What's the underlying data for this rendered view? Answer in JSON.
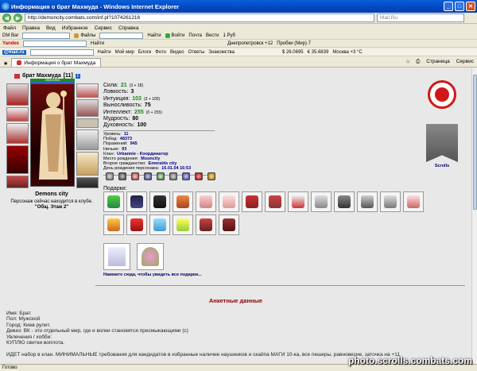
{
  "window": {
    "title": "Информация о брат Махмуда - Windows Internet Explorer"
  },
  "address": {
    "url": "http://demoncity.combats.com/inf.pl?1074261216",
    "search": "Mail.Ru"
  },
  "menu": [
    "Файл",
    "Правка",
    "Вид",
    "Избранное",
    "Сервис",
    "Справка"
  ],
  "toolbar1": {
    "dm": "DM Bar",
    "files": "Файлы",
    "find": "Найти",
    "enter": "Войти",
    "mail": "Почта",
    "news": "Вести",
    "rate": "1 Руб"
  },
  "toolbar2": {
    "yandex": "Yandex",
    "find": "Найти",
    "city": "Днепропетровск +12",
    "traffic": "Пробки (Мир) 7"
  },
  "toolbar3": {
    "mailru": "@mail.ru",
    "find": "Найти",
    "mymir": "Мой мир",
    "blogs": "Блоги",
    "photo": "Фото",
    "video": "Видео",
    "answers": "Ответы",
    "znak": "Знакомства",
    "usd": "$ 26.0695",
    "eur": "€ 35.6839",
    "moscow": "Москва +3 °C"
  },
  "tab": {
    "label": "Информация о брат Махмуда"
  },
  "tabtools": {
    "page": "Страница",
    "service": "Сервис"
  },
  "character": {
    "name": "брат Махмуда",
    "level": "[11]",
    "hp": "2500/2500",
    "city": "Demons city",
    "location_line": "Персонаж сейчас находится в клубе.",
    "location_room": "\"Общ. Этаж 2\""
  },
  "stats": [
    {
      "label": "Сила:",
      "value": "21",
      "extra": "(3 + 18)",
      "green": true
    },
    {
      "label": "Ловкость:",
      "value": "3",
      "extra": "",
      "green": false
    },
    {
      "label": "Интуиция:",
      "value": "103",
      "extra": "(3 + 100)",
      "green": true
    },
    {
      "label": "Выносливость:",
      "value": "75",
      "extra": "",
      "green": false
    },
    {
      "label": "Интеллект:",
      "value": "255",
      "extra": "(0 + 255)",
      "green": true
    },
    {
      "label": "Мудрость:",
      "value": "80",
      "extra": "",
      "green": false
    },
    {
      "label": "Духовность:",
      "value": "100",
      "extra": "",
      "green": false
    }
  ],
  "info": [
    {
      "label": "Уровень:",
      "value": "11"
    },
    {
      "label": "Побед:",
      "value": "48373"
    },
    {
      "label": "Поражений:",
      "value": "945"
    },
    {
      "label": "Ничьих:",
      "value": "93"
    },
    {
      "label": "Клан:",
      "value": "Urbannie - Координатор"
    },
    {
      "label": "Место рождения:",
      "value": "Mooncity"
    },
    {
      "label": "Второе гражданство:",
      "value": "Emeralds city"
    },
    {
      "label": "День рождения персонажа:",
      "value": "16.01.04 16:53"
    }
  ],
  "clan_banner": "Scrolls",
  "gifts_label": "Подарки:",
  "gifts_more": "Нажмите сюда, чтобы увидеть все подарки...",
  "anketa": {
    "heading": "Анкетные данные",
    "lines": [
      "Имя: Брат.",
      "Пол: Мужской",
      "Город: Киев рулит.",
      "Девиз: ВК - это отдельный мир, где и волки становятся пресмыкающими (с)",
      "Увлечения / хобби:",
      "КУПЛЮ свитки воплота.",
      "",
      "ИДЕТ набор в клан. МИНИМАЛЬНЫЕ требования для кандидатов в избранные   наличие наушников и скайпа МАГИ 10-ка, все пешеры, равновесие, заточка на +11"
    ]
  },
  "status": "Готово",
  "watermark": "photo.scrolls.combats.com",
  "colors": {
    "stat_green": "#1a8a1a",
    "heading_red": "#8b0000",
    "clan_red": "#d01818"
  }
}
